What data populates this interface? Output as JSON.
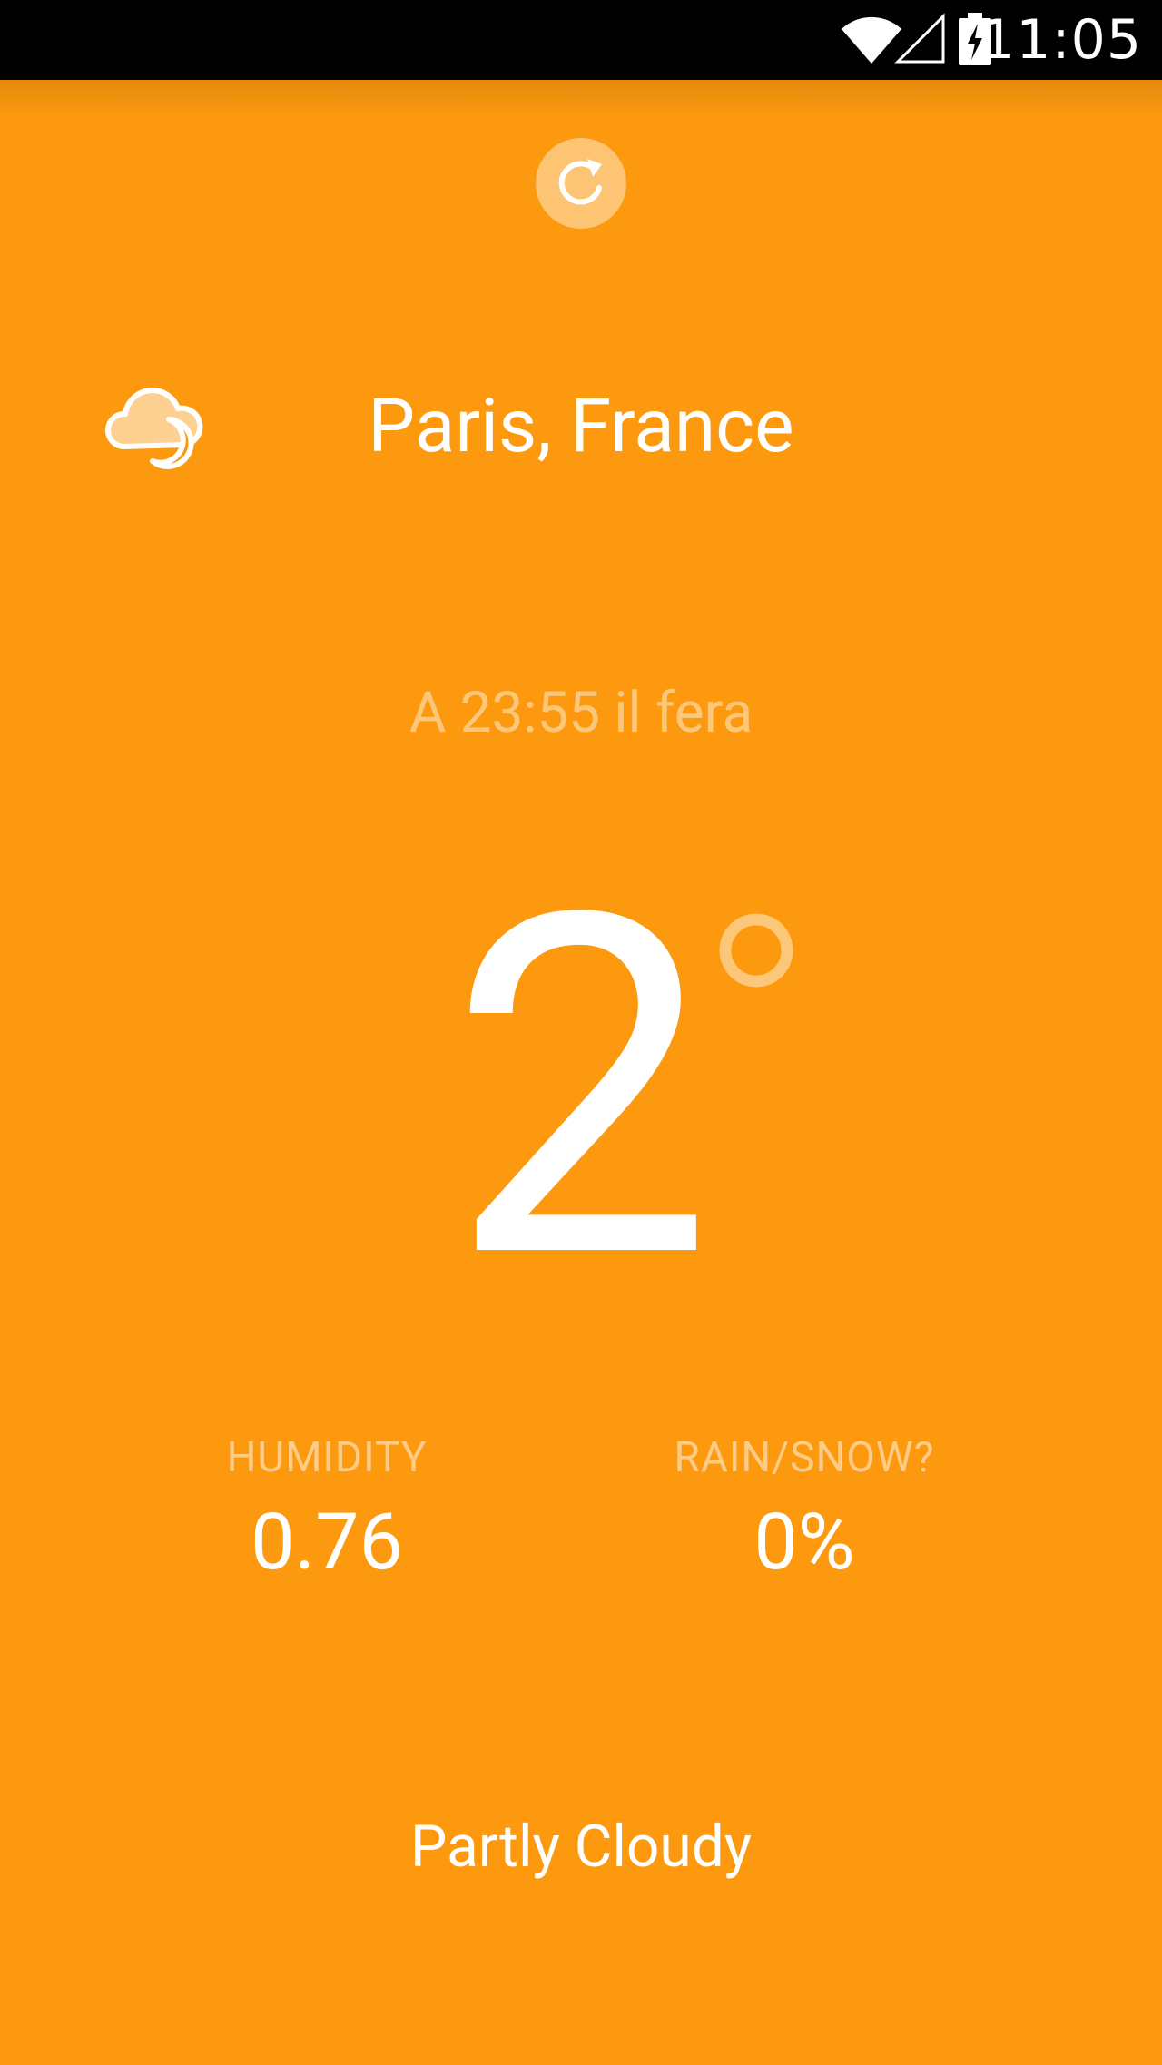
{
  "status_bar": {
    "time": "11:05",
    "icons": [
      "wifi-icon",
      "cell-signal-icon",
      "battery-charging-icon"
    ]
  },
  "toolbar": {
    "refresh_icon": "refresh-icon"
  },
  "weather": {
    "icon": "partly-cloudy-night-icon",
    "location": "Paris, France",
    "timestamp": "A 23:55 il fera",
    "temperature": "2",
    "degree_icon": "degree-icon",
    "humidity": {
      "label": "HUMIDITY",
      "value": "0.76"
    },
    "precipitation": {
      "label": "RAIN/SNOW?",
      "value": "0%"
    },
    "summary": "Partly Cloudy"
  },
  "colors": {
    "background": "#FC990E",
    "status_bar": "#000000",
    "text_primary": "#FFFFFF",
    "text_muted": "rgba(255,255,255,0.45)"
  }
}
